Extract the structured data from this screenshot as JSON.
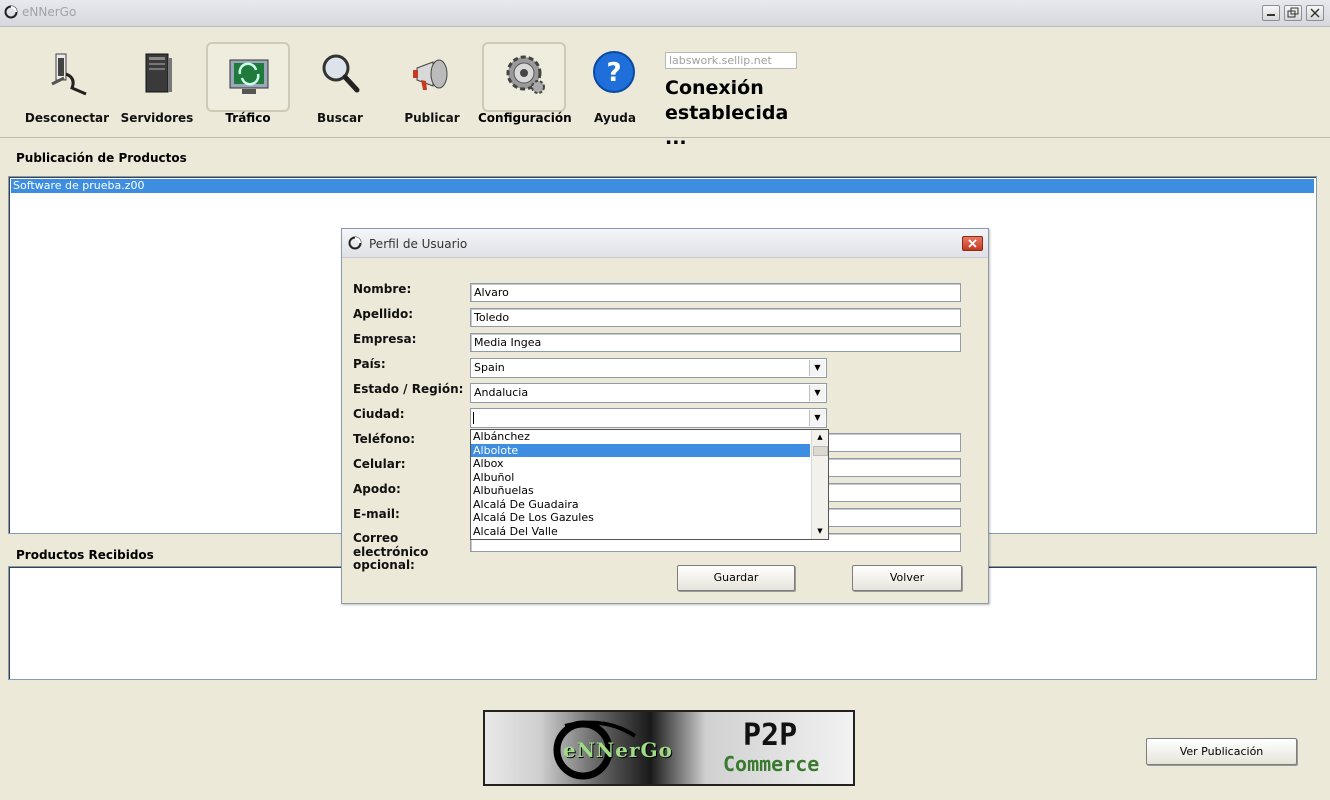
{
  "window": {
    "title": "eNNerGo"
  },
  "toolbar": {
    "buttons": [
      {
        "label": "Desconectar",
        "icon": "disconnect-plug-icon"
      },
      {
        "label": "Servidores",
        "icon": "server-tower-icon"
      },
      {
        "label": "Tráfico",
        "icon": "traffic-monitor-icon"
      },
      {
        "label": "Buscar",
        "icon": "magnifier-icon"
      },
      {
        "label": "Publicar",
        "icon": "megaphone-icon"
      },
      {
        "label": "Configuración",
        "icon": "gear-icon"
      },
      {
        "label": "Ayuda",
        "icon": "help-question-icon"
      }
    ],
    "selected": [
      "Tráfico",
      "Configuración"
    ],
    "server": "labswork.sellip.net",
    "status_line1": "Conexión",
    "status_line2": "establecida ..."
  },
  "published": {
    "title": "Publicación de Productos",
    "items": [
      "Software de prueba.z00"
    ]
  },
  "received": {
    "title": "Productos Recibidos",
    "items": []
  },
  "dialog": {
    "title": "Perfil de Usuario",
    "labels": {
      "nombre": "Nombre:",
      "apellido": "Apellido:",
      "empresa": "Empresa:",
      "pais": "País:",
      "estado": "Estado / Región:",
      "ciudad": "Ciudad:",
      "telefono": "Teléfono:",
      "celular": "Celular:",
      "apodo": "Apodo:",
      "email": "E-mail:",
      "correo1": "Correo",
      "correo2": "electrónico",
      "correo3": "opcional:"
    },
    "values": {
      "nombre": "Alvaro",
      "apellido": "Toledo",
      "empresa": "Media Ingea",
      "pais": "Spain",
      "estado": "Andalucia",
      "ciudad": ""
    },
    "city_options": [
      "Albánchez",
      "Albolote",
      "Albox",
      "Albuñol",
      "Albuñuelas",
      "Alcalá De Guadaira",
      "Alcalá De Los Gazules",
      "Alcalá Del Valle"
    ],
    "city_highlighted": "Albolote",
    "save_label": "Guardar",
    "back_label": "Volver"
  },
  "logo": {
    "text_left": "eNNerGo",
    "text_right_1": "P2P",
    "text_right_2": "Commerce"
  },
  "view_publication_label": "Ver Publicación",
  "colors": {
    "accent": "#3d8ee0",
    "background": "#ece9d8"
  }
}
